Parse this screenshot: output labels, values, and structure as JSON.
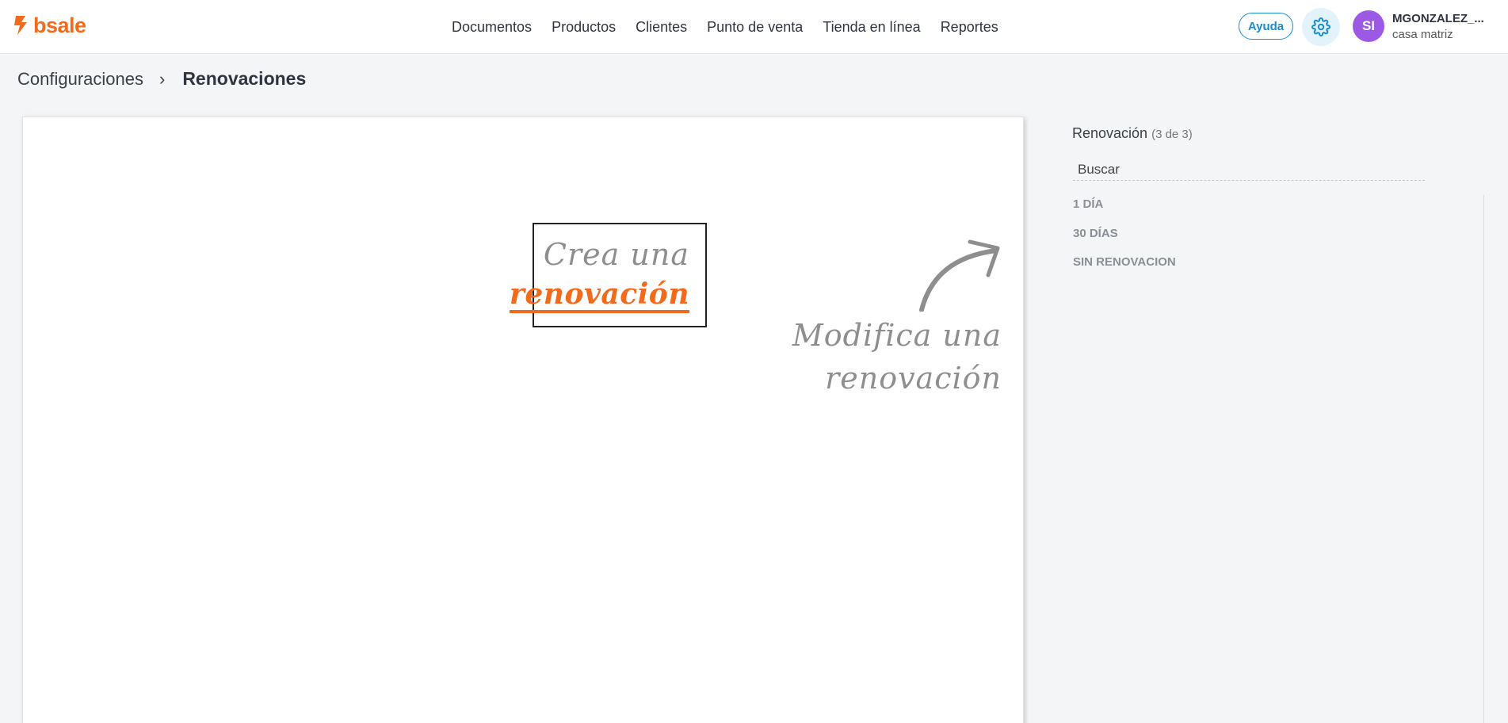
{
  "brand": {
    "name": "bsale",
    "color": "#f26b1d"
  },
  "nav": {
    "items": [
      "Documentos",
      "Productos",
      "Clientes",
      "Punto de venta",
      "Tienda en línea",
      "Reportes"
    ]
  },
  "header": {
    "help_label": "Ayuda",
    "settings_icon": "gear-icon",
    "avatar_initials": "SI",
    "user_name": "MGONZALEZ_...",
    "branch": "casa matriz"
  },
  "breadcrumb": {
    "parent": "Configuraciones",
    "separator": "›",
    "current": "Renovaciones"
  },
  "main": {
    "create_line1": "Crea una",
    "create_line2": "renovación",
    "modify_line1": "Modifica una",
    "modify_line2": "renovación"
  },
  "sidebar": {
    "title": "Renovación",
    "count": "(3 de 3)",
    "search_placeholder": "Buscar",
    "items": [
      "1 DÍA",
      "30 DÍAS",
      "SIN RENOVACION"
    ]
  },
  "colors": {
    "accent": "#f26b1d",
    "link_blue": "#1a8ccc",
    "avatar": "#9b59e6"
  }
}
